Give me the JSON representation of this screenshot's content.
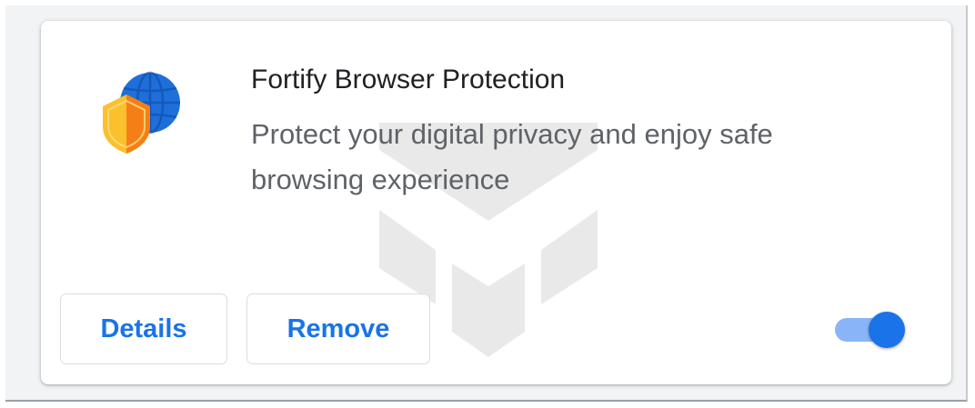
{
  "extension": {
    "name": "Fortify Browser Protection",
    "description": "Protect your digital privacy and enjoy safe browsing experience",
    "icon": "globe-shield-icon",
    "enabled": true
  },
  "buttons": {
    "details_label": "Details",
    "remove_label": "Remove"
  },
  "colors": {
    "accent": "#1a73e8",
    "toggle_track": "#8ab4f8",
    "globe": "#1a73e8",
    "shield": "#f9a825",
    "title_text": "#202124",
    "description_text": "#5f6368"
  },
  "watermark": "shield-logo-watermark"
}
